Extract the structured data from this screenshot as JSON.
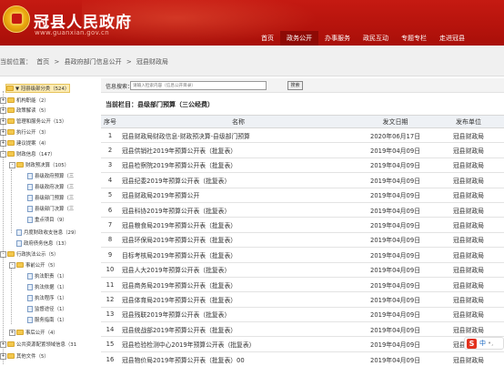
{
  "header": {
    "title": "冠县人民政府",
    "url": "www.guanxian.gov.cn",
    "nav": [
      "首页",
      "政务公开",
      "办事服务",
      "政民互动",
      "专题专栏",
      "走进冠县"
    ],
    "nav_active_index": 1,
    "colors": {
      "header": "#b5130c",
      "active_nav": "#8e0a05"
    }
  },
  "breadcrumb": {
    "prefix": "当前位置：",
    "items": [
      "首页",
      ">",
      "县政府部门信息公开",
      ">",
      "冠县财政局"
    ]
  },
  "sidebar": {
    "items": [
      {
        "toggle": "+",
        "label": "▼ 冠县级部分类（524）",
        "selected": true
      },
      {
        "toggle": "+",
        "label": "机构职能（2）"
      },
      {
        "toggle": "+",
        "label": "政策解读（5）"
      },
      {
        "toggle": "+",
        "label": "管理和服务公开（13）"
      },
      {
        "toggle": "+",
        "label": "执行公开（3）"
      },
      {
        "toggle": "+",
        "label": "建议提案（4）"
      },
      {
        "toggle": "-",
        "label": "财政信息（147）"
      },
      {
        "toggle": "-",
        "label": "财政预决算（105）"
      },
      {
        "toggle": "",
        "label": "县级政府预算（三"
      },
      {
        "toggle": "",
        "label": "县级政府决算（三"
      },
      {
        "toggle": "",
        "label": "县级部门预算（三"
      },
      {
        "toggle": "",
        "label": "县级部门决算（三"
      },
      {
        "toggle": "",
        "label": "重点项目（9）"
      },
      {
        "toggle": "",
        "label": "月度财政收支信息（29）"
      },
      {
        "toggle": "",
        "label": "政府债务信息（13）"
      },
      {
        "toggle": "-",
        "label": "行政执法公示（5）"
      },
      {
        "toggle": "-",
        "label": "事前公开（5）"
      },
      {
        "toggle": "",
        "label": "执法职责（1）"
      },
      {
        "toggle": "",
        "label": "执法依据（1）"
      },
      {
        "toggle": "",
        "label": "执法程序（1）"
      },
      {
        "toggle": "",
        "label": "监督途径（1）"
      },
      {
        "toggle": "",
        "label": "服务指南（1）"
      },
      {
        "toggle": "+",
        "label": "事后公开（4）"
      },
      {
        "toggle": "+",
        "label": "公共资源配置领域信息（31"
      },
      {
        "toggle": "+",
        "label": "其他文件（5）"
      }
    ]
  },
  "search": {
    "label": "信息搜索：",
    "placeholder": "请输入检索内容（信息公开目录）",
    "button_label": "搜索"
  },
  "section_title": "当前栏目：县级部门预算（三公经费）",
  "table": {
    "headers": [
      "序号",
      "名称",
      "发文日期",
      "发布单位"
    ],
    "rows": [
      {
        "no": "1",
        "title": "冠县财政局财政信息-财政预决算-县级部门预算",
        "date": "2020年06月17日",
        "publisher": "冠县财政局"
      },
      {
        "no": "2",
        "title": "冠县供销社2019年预算公开表（批复表）",
        "date": "2019年04月09日",
        "publisher": "冠县财政局"
      },
      {
        "no": "3",
        "title": "冠县检察院2019年预算公开表（批复表）",
        "date": "2019年04月09日",
        "publisher": "冠县财政局"
      },
      {
        "no": "4",
        "title": "冠县纪委2019年预算公开表（批复表）",
        "date": "2019年04月09日",
        "publisher": "冠县财政局"
      },
      {
        "no": "5",
        "title": "冠县财政局2019年预算公开",
        "date": "2019年04月09日",
        "publisher": "冠县财政局"
      },
      {
        "no": "6",
        "title": "冠县科协2019年预算公开表（批复表）",
        "date": "2019年04月09日",
        "publisher": "冠县财政局"
      },
      {
        "no": "7",
        "title": "冠县粮食局2019年预算公开表（批复表）",
        "date": "2019年04月09日",
        "publisher": "冠县财政局"
      },
      {
        "no": "8",
        "title": "冠县环保局2019年预算公开表（批复表）",
        "date": "2019年04月09日",
        "publisher": "冠县财政局"
      },
      {
        "no": "9",
        "title": "目标考核局2019年预算公开表（批复表）",
        "date": "2019年04月09日",
        "publisher": "冠县财政局"
      },
      {
        "no": "10",
        "title": "冠县人大2019年预算公开表（批复表）",
        "date": "2019年04月09日",
        "publisher": "冠县财政局"
      },
      {
        "no": "11",
        "title": "冠县商务局2019年预算公开表（批复表）",
        "date": "2019年04月09日",
        "publisher": "冠县财政局"
      },
      {
        "no": "12",
        "title": "冠县体育局2019年预算公开表（批复表）",
        "date": "2019年04月09日",
        "publisher": "冠县财政局"
      },
      {
        "no": "13",
        "title": "冠县残联2019年预算公开表（批复表）",
        "date": "2019年04月09日",
        "publisher": "冠县财政局"
      },
      {
        "no": "14",
        "title": "冠县统战部2019年预算公开表（批复表）",
        "date": "2019年04月09日",
        "publisher": "冠县财政局"
      },
      {
        "no": "15",
        "title": "冠县检验检测中心2019年预算公开表（批复表）",
        "date": "2019年04月09日",
        "publisher": "冠县财政局"
      },
      {
        "no": "16",
        "title": "冠县物价局2019年预算公开表（批复表）00",
        "date": "2019年04月09日",
        "publisher": "冠县财政局"
      }
    ]
  },
  "ime": {
    "logo": "S",
    "mode": "中",
    "extra": "•,"
  }
}
